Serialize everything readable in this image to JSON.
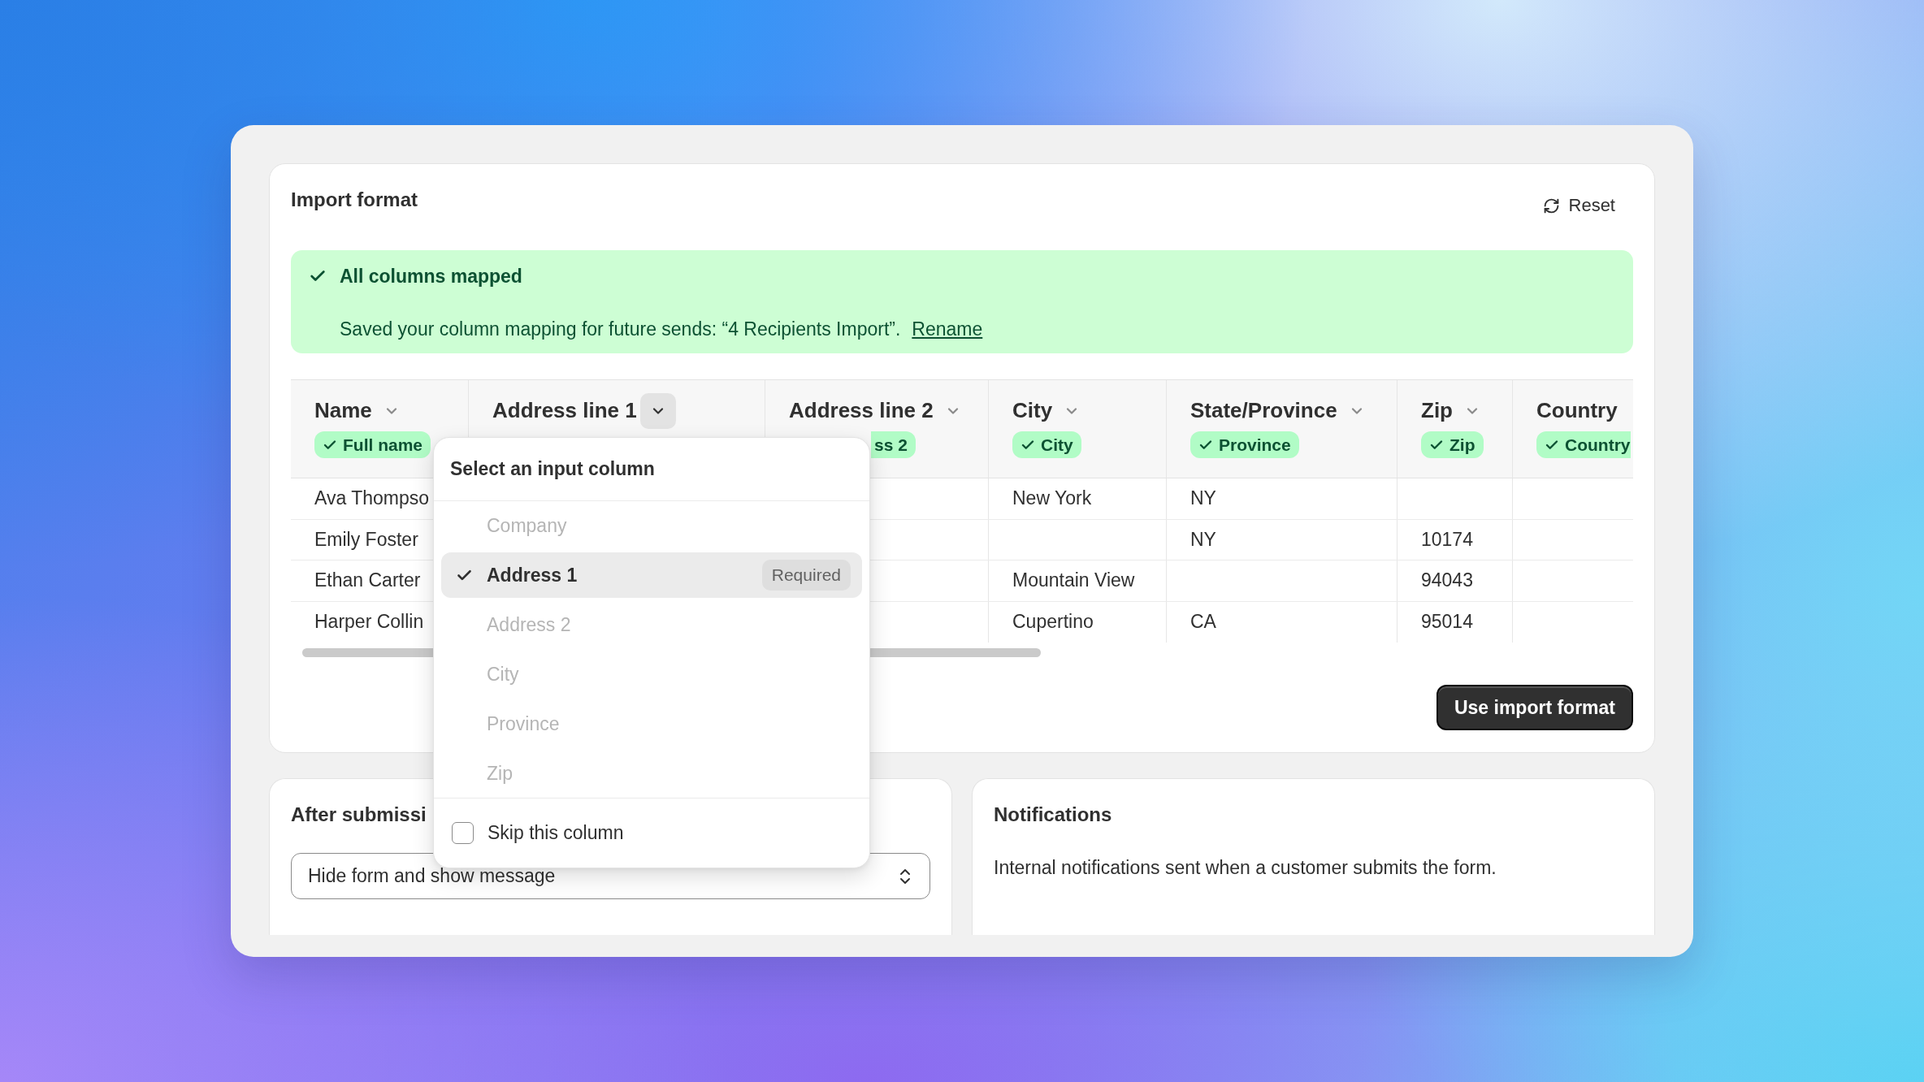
{
  "card": {
    "title": "Import format",
    "reset_button": "Reset",
    "primary_button": "Use import format"
  },
  "banner": {
    "title": "All columns mapped",
    "message": "Saved your column mapping for future sends: “4 Recipients Import”.",
    "link": "Rename"
  },
  "table": {
    "columns": [
      {
        "label": "Name",
        "menu_open": false,
        "mapping": {
          "label": "Full name",
          "matched": true
        }
      },
      {
        "label": "Address line 1",
        "menu_open": true
      },
      {
        "label": "Address line 2",
        "menu_open": false,
        "mapping": {
          "label": "ss 2",
          "matched": true,
          "covered_left": true
        }
      },
      {
        "label": "City",
        "menu_open": false,
        "mapping": {
          "label": "City",
          "matched": true
        }
      },
      {
        "label": "State/Province",
        "menu_open": false,
        "mapping": {
          "label": "Province",
          "matched": true
        }
      },
      {
        "label": "Zip",
        "menu_open": false,
        "mapping": {
          "label": "Zip",
          "matched": true
        }
      },
      {
        "label": "Country",
        "mapping": {
          "label": "Country",
          "matched": true,
          "cut_off_right": true
        }
      }
    ],
    "rows": [
      {
        "name": "Ava Thompso",
        "city": "New York",
        "state_province": "NY"
      },
      {
        "name": "Emily Foster",
        "state_province": "NY",
        "zip": "10174"
      },
      {
        "name": "Ethan Carter",
        "city": "Mountain View",
        "zip": "94043"
      },
      {
        "name": "Harper Collin",
        "city": "Cupertino",
        "state_province": "CA",
        "zip": "95014"
      }
    ]
  },
  "dropdown": {
    "title": "Select an input column",
    "items": [
      {
        "label": "Company",
        "selected": false,
        "disabled": true
      },
      {
        "label": "Address 1",
        "selected": true,
        "disabled": false,
        "badge": "Required"
      },
      {
        "label": "Address 2",
        "selected": false,
        "disabled": true
      },
      {
        "label": "City",
        "selected": false,
        "disabled": true
      },
      {
        "label": "Province",
        "selected": false,
        "disabled": true
      },
      {
        "label": "Zip",
        "selected": false,
        "disabled": true
      }
    ],
    "skip": {
      "label": "Skip this column",
      "checked": false
    }
  },
  "after_submission": {
    "title": "After submissi",
    "select": {
      "value": "Hide form and show message"
    }
  },
  "notifications": {
    "title": "Notifications",
    "description": "Internal notifications sent when a customer submits the form."
  }
}
